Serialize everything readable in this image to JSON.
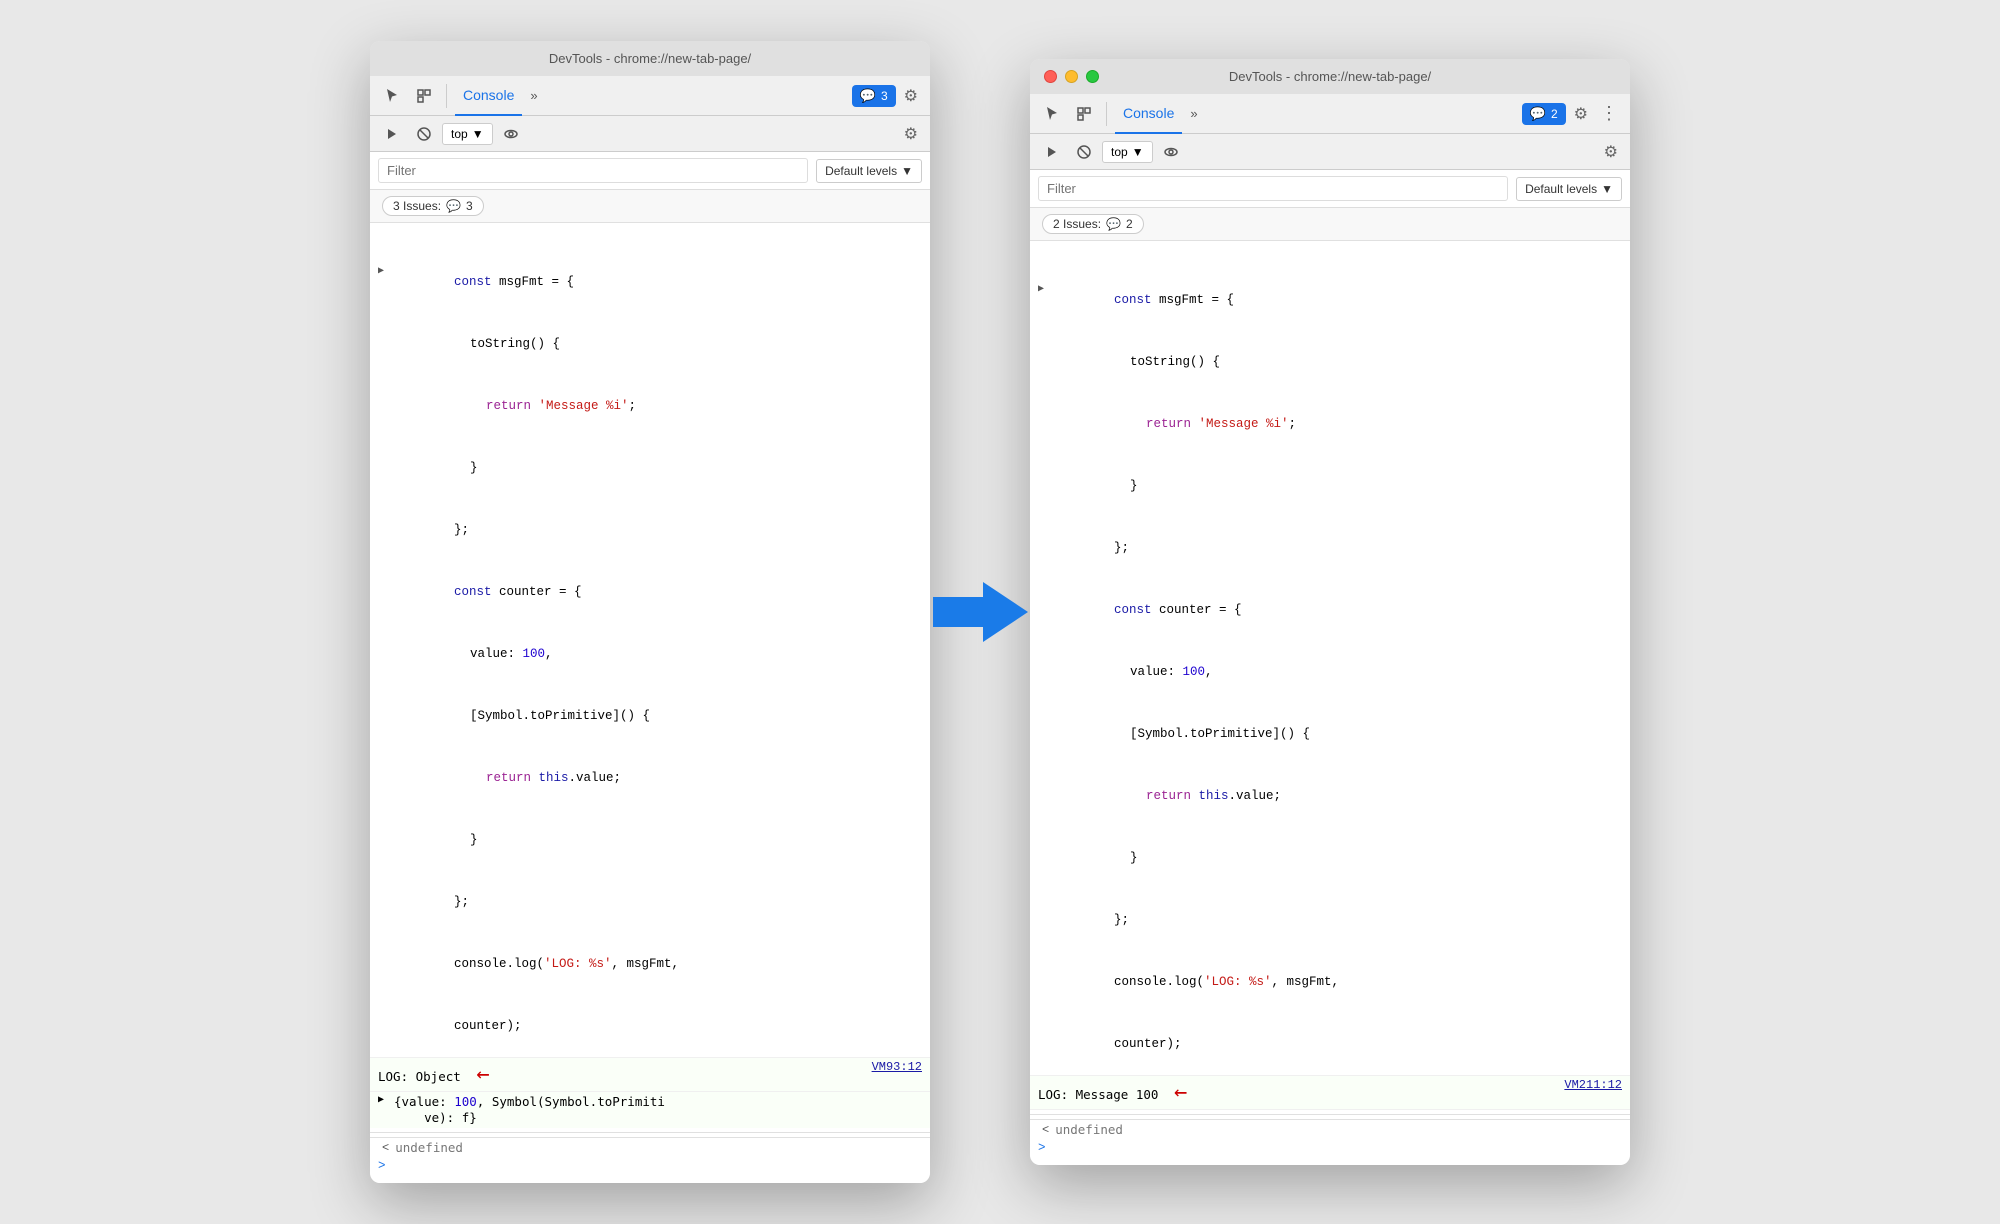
{
  "window_left": {
    "title": "DevTools - chrome://new-tab-page/",
    "tab_label": "Console",
    "issues_count": "3",
    "issues_badge_label": "3",
    "top_label": "top",
    "filter_placeholder": "Filter",
    "default_levels_label": "Default levels",
    "issues_bar_label": "3 Issues:",
    "issues_bar_count": "3",
    "code_lines": [
      {
        "type": "code",
        "content": "const msgFmt = {",
        "indent": 0,
        "has_arrow": true
      },
      {
        "type": "code",
        "content": "  toString() {",
        "indent": 1
      },
      {
        "type": "code",
        "content": "    return 'Message %i';",
        "indent": 2
      },
      {
        "type": "code",
        "content": "  }",
        "indent": 1
      },
      {
        "type": "code",
        "content": "};",
        "indent": 0
      },
      {
        "type": "code",
        "content": "const counter = {",
        "indent": 0
      },
      {
        "type": "code",
        "content": "  value: 100,",
        "indent": 1
      },
      {
        "type": "code",
        "content": "  [Symbol.toPrimitive]() {",
        "indent": 1
      },
      {
        "type": "code",
        "content": "    return this.value;",
        "indent": 2
      },
      {
        "type": "code",
        "content": "  }",
        "indent": 1
      },
      {
        "type": "code",
        "content": "};",
        "indent": 0
      },
      {
        "type": "code",
        "content": "console.log('LOG: %s', msgFmt,",
        "indent": 0
      },
      {
        "type": "code",
        "content": "counter);",
        "indent": 0
      }
    ],
    "log_output": "LOG: Object",
    "vm_ref": "VM93:12",
    "expand_obj": "{value: 100, Symbol(Symbol.toPrimiti\n    ve): f}",
    "undefined_label": "undefined",
    "prompt": ">"
  },
  "window_right": {
    "title": "DevTools - chrome://new-tab-page/",
    "tab_label": "Console",
    "issues_count": "2",
    "issues_badge_label": "2",
    "top_label": "top",
    "filter_placeholder": "Filter",
    "default_levels_label": "Default levels",
    "issues_bar_label": "2 Issues:",
    "issues_bar_count": "2",
    "code_lines": [
      {
        "type": "code",
        "content": "const msgFmt = {",
        "indent": 0,
        "has_arrow": true
      },
      {
        "type": "code",
        "content": "  toString() {",
        "indent": 1
      },
      {
        "type": "code",
        "content": "    return 'Message %i';",
        "indent": 2
      },
      {
        "type": "code",
        "content": "  }",
        "indent": 1
      },
      {
        "type": "code",
        "content": "};",
        "indent": 0
      },
      {
        "type": "code",
        "content": "const counter = {",
        "indent": 0
      },
      {
        "type": "code",
        "content": "  value: 100,",
        "indent": 1
      },
      {
        "type": "code",
        "content": "  [Symbol.toPrimitive]() {",
        "indent": 1
      },
      {
        "type": "code",
        "content": "    return this.value;",
        "indent": 2
      },
      {
        "type": "code",
        "content": "  }",
        "indent": 1
      },
      {
        "type": "code",
        "content": "};",
        "indent": 0
      },
      {
        "type": "code",
        "content": "console.log('LOG: %s', msgFmt,",
        "indent": 0
      },
      {
        "type": "code",
        "content": "counter);",
        "indent": 0
      }
    ],
    "log_output": "LOG: Message 100",
    "vm_ref": "VM211:12",
    "undefined_label": "undefined",
    "prompt": ">"
  },
  "icons": {
    "cursor": "↖",
    "layers": "⊡",
    "chevron_right": "»",
    "gear": "⚙",
    "dots": "⋮",
    "play": "▶",
    "ban": "⊘",
    "eye": "👁",
    "message": "💬",
    "triangle_right": "▶",
    "chevron_down": "▼"
  }
}
